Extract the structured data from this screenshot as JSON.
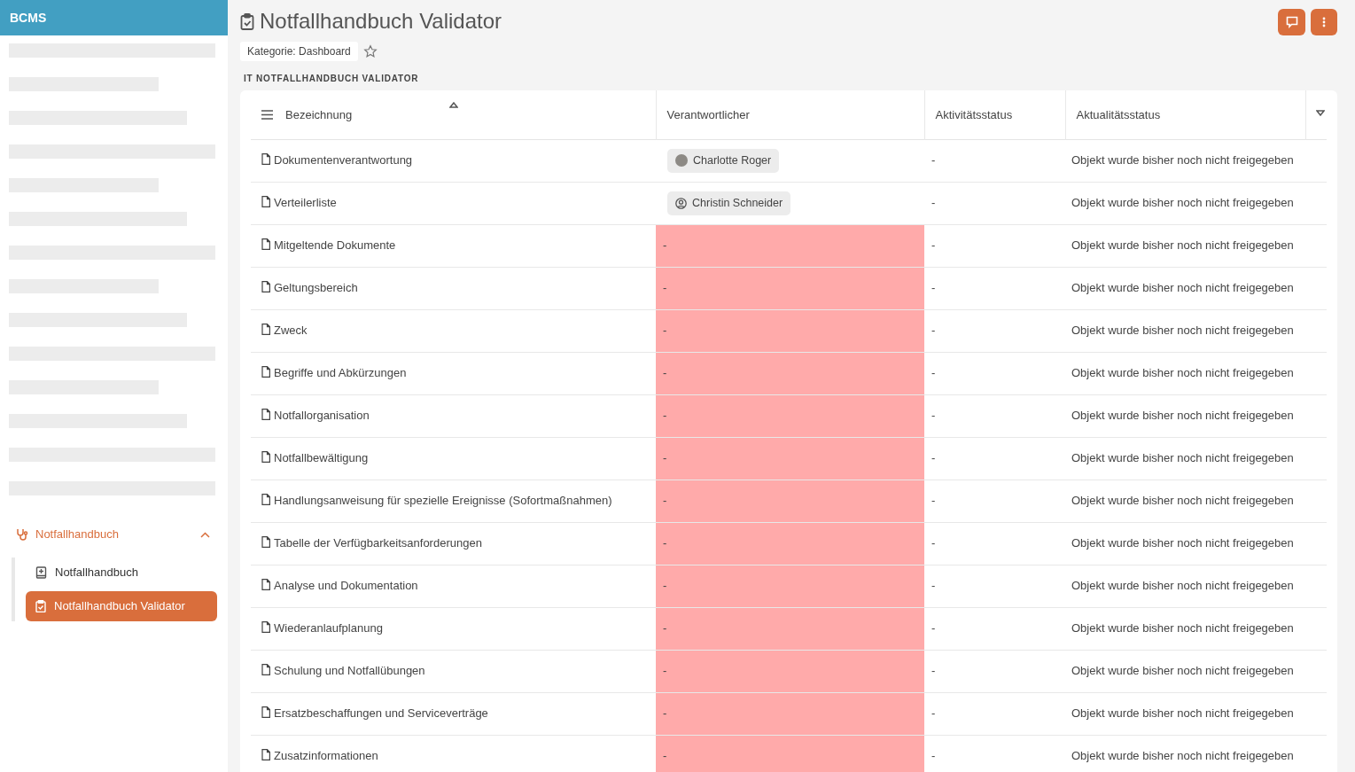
{
  "app": {
    "title": "BCMS"
  },
  "sidebar": {
    "group": {
      "label": "Notfallhandbuch",
      "expanded": true
    },
    "items": [
      {
        "label": "Notfallhandbuch",
        "kind": "book",
        "selected": false
      },
      {
        "label": "Notfallhandbuch Validator",
        "kind": "clipboard",
        "selected": true
      }
    ]
  },
  "page": {
    "title": "Notfallhandbuch Validator",
    "category": "Kategorie: Dashboard",
    "favorite": false,
    "section": "IT NOTFALLHANDBUCH VALIDATOR"
  },
  "table": {
    "columns": [
      {
        "label": "Bezeichnung",
        "sorted": true
      },
      {
        "label": "Verantwortlicher"
      },
      {
        "label": "Aktivitätsstatus"
      },
      {
        "label": "Aktualitätsstatus"
      }
    ],
    "rows": [
      {
        "name": "Dokumentenverantwortung",
        "responsible": {
          "kind": "photo",
          "text": "Charlotte Roger"
        },
        "activity": "-",
        "status": "Objekt wurde bisher noch nicht freigegeben"
      },
      {
        "name": "Verteilerliste",
        "responsible": {
          "kind": "generic",
          "text": "Christin Schneider"
        },
        "activity": "-",
        "status": "Objekt wurde bisher noch nicht freigegeben"
      },
      {
        "name": "Mitgeltende Dokumente",
        "responsible": {
          "kind": "missing",
          "text": "-"
        },
        "activity": "-",
        "status": "Objekt wurde bisher noch nicht freigegeben"
      },
      {
        "name": "Geltungsbereich",
        "responsible": {
          "kind": "missing",
          "text": "-"
        },
        "activity": "-",
        "status": "Objekt wurde bisher noch nicht freigegeben"
      },
      {
        "name": "Zweck",
        "responsible": {
          "kind": "missing",
          "text": "-"
        },
        "activity": "-",
        "status": "Objekt wurde bisher noch nicht freigegeben"
      },
      {
        "name": "Begriffe und Abkürzungen",
        "responsible": {
          "kind": "missing",
          "text": "-"
        },
        "activity": "-",
        "status": "Objekt wurde bisher noch nicht freigegeben"
      },
      {
        "name": "Notfallorganisation",
        "responsible": {
          "kind": "missing",
          "text": "-"
        },
        "activity": "-",
        "status": "Objekt wurde bisher noch nicht freigegeben"
      },
      {
        "name": "Notfallbewältigung",
        "responsible": {
          "kind": "missing",
          "text": "-"
        },
        "activity": "-",
        "status": "Objekt wurde bisher noch nicht freigegeben"
      },
      {
        "name": "Handlungsanweisung für spezielle Ereignisse (Sofortmaßnahmen)",
        "responsible": {
          "kind": "missing",
          "text": "-"
        },
        "activity": "-",
        "status": "Objekt wurde bisher noch nicht freigegeben"
      },
      {
        "name": "Tabelle der Verfügbarkeitsanforderungen",
        "responsible": {
          "kind": "missing",
          "text": "-"
        },
        "activity": "-",
        "status": "Objekt wurde bisher noch nicht freigegeben"
      },
      {
        "name": "Analyse und Dokumentation",
        "responsible": {
          "kind": "missing",
          "text": "-"
        },
        "activity": "-",
        "status": "Objekt wurde bisher noch nicht freigegeben"
      },
      {
        "name": "Wiederanlaufplanung",
        "responsible": {
          "kind": "missing",
          "text": "-"
        },
        "activity": "-",
        "status": "Objekt wurde bisher noch nicht freigegeben"
      },
      {
        "name": "Schulung und Notfallübungen",
        "responsible": {
          "kind": "missing",
          "text": "-"
        },
        "activity": "-",
        "status": "Objekt wurde bisher noch nicht freigegeben"
      },
      {
        "name": "Ersatzbeschaffungen und Serviceverträge",
        "responsible": {
          "kind": "missing",
          "text": "-"
        },
        "activity": "-",
        "status": "Objekt wurde bisher noch nicht freigegeben"
      },
      {
        "name": "Zusatzinformationen",
        "responsible": {
          "kind": "missing",
          "text": "-"
        },
        "activity": "-",
        "status": "Objekt wurde bisher noch nicht freigegeben"
      }
    ]
  }
}
